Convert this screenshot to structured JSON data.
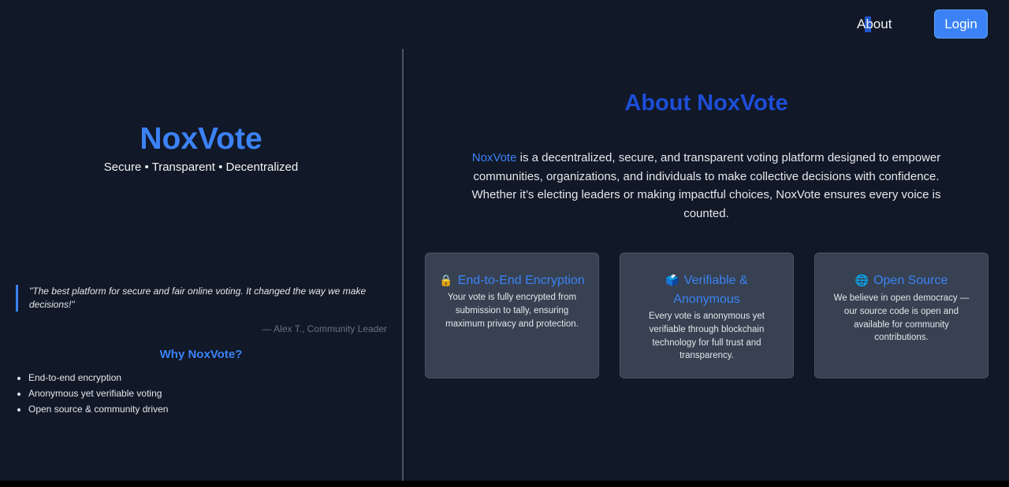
{
  "nav": {
    "about_label": "About",
    "login_label": "Login"
  },
  "left": {
    "brand": "NoxVote",
    "tagline": "Secure • Transparent • Decentralized",
    "quote": "\"The best platform for secure and fair online voting. It changed the way we make decisions!\"",
    "quote_author": "— Alex T., Community Leader",
    "why_title": "Why NoxVote?",
    "why_items": [
      "End-to-end encryption",
      "Anonymous yet verifiable voting",
      "Open source & community driven"
    ]
  },
  "about": {
    "title": "About NoxVote",
    "highlight": "NoxVote",
    "body": " is a decentralized, secure, and transparent voting platform designed to empower communities, organizations, and individuals to make collective decisions with confidence. Whether it’s electing leaders or making impactful choices, NoxVote ensures every voice is counted."
  },
  "features": [
    {
      "icon": "🔒",
      "icon_name": "lock-icon",
      "title": "End-to-End Encryption",
      "desc": "Your vote is fully encrypted from submission to tally, ensuring maximum privacy and protection."
    },
    {
      "icon": "🗳️",
      "icon_name": "ballot-box-icon",
      "title": "Verifiable & Anonymous",
      "desc": "Every vote is anonymous yet verifiable through blockchain technology for full trust and transparency."
    },
    {
      "icon": "🌐",
      "icon_name": "globe-icon",
      "title": "Open Source",
      "desc": "We believe in open democracy — our source code is open and available for community contributions."
    }
  ],
  "colors": {
    "background": "#111827",
    "accent": "#3b82f6",
    "card": "#374151"
  }
}
